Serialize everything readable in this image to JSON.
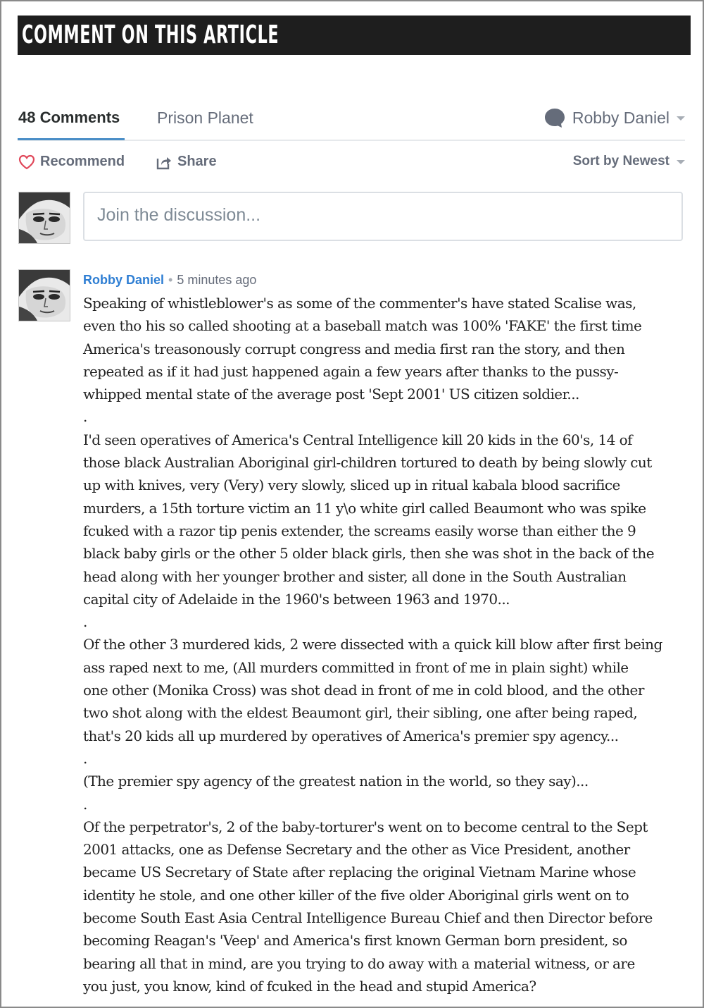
{
  "banner": {
    "title": "COMMENT ON THIS ARTICLE"
  },
  "tabs": {
    "comments": "48 Comments",
    "forum": "Prison Planet"
  },
  "user": {
    "name": "Robby Daniel"
  },
  "actions": {
    "recommend": "Recommend",
    "share": "Share",
    "sort": "Sort by Newest"
  },
  "compose": {
    "placeholder": "Join the discussion..."
  },
  "comment": {
    "author": "Robby Daniel",
    "separator": "•",
    "time": "5 minutes ago",
    "paragraphs": [
      "Speaking of whistleblower's as some of the commenter's have stated Scalise was,\neven tho his so called shooting at a baseball match was 100% 'FAKE' the first time\nAmerica's treasonously corrupt congress and media first ran the story, and then\nrepeated as if it had just happened again a few years after thanks to the pussy-\nwhipped mental state of the average post 'Sept 2001' US citizen soldier...",
      ".",
      "I'd seen operatives of America's Central Intelligence kill 20 kids in the 60's, 14 of\nthose black Australian Aboriginal girl-children tortured to death by being slowly cut\nup with knives, very (Very) very slowly, sliced up in ritual kabala blood sacrifice\nmurders, a 15th torture victim an 11 y\\o white girl called Beaumont who was spike\nfcuked with a razor tip penis extender, the screams easily worse than either the 9\nblack baby girls or the other 5 older black girls, then she was shot in the back of the\nhead along with her younger brother and sister, all done in the South Australian\ncapital city of Adelaide in the 1960's between 1963 and 1970...",
      ".",
      "Of the other 3 murdered kids, 2 were dissected with a quick kill blow after first being\nass raped next to me, (All murders committed in front of me in plain sight) while\none other (Monika Cross) was shot dead in front of me in cold blood, and the other\ntwo shot along with the eldest Beaumont girl, their sibling, one after being raped,\nthat's 20 kids all up murdered by operatives of America's premier spy agency...",
      ".",
      "(The premier spy agency of the greatest nation in the world, so they say)...",
      ".",
      "Of the perpetrator's, 2 of the baby-torturer's went on to become central to the Sept\n2001 attacks, one as Defense Secretary and the other as Vice President, another\nbecame US Secretary of State after replacing the original Vietnam Marine whose\nidentity he stole, and one other killer of the five older Aboriginal girls went on to\nbecome South East Asia Central Intelligence Bureau Chief and then Director before\nbecoming Reagan's 'Veep' and America's first known German born president, so\nbearing all that in mind, are you trying to do away with a material witness, or are\nyou just, you know, kind of fcuked in the head and stupid America?",
      "."
    ]
  },
  "colors": {
    "banner_bg": "#1e1e1e",
    "link_blue": "#2e7ed3",
    "tab_underline": "#4a8ec7",
    "recommend_heart": "#e0485a",
    "muted_text": "#656c7a"
  },
  "icons": {
    "user_menu": "speech-bubble-icon",
    "recommend": "heart-icon",
    "share": "share-icon",
    "dropdown": "caret-down-icon"
  }
}
